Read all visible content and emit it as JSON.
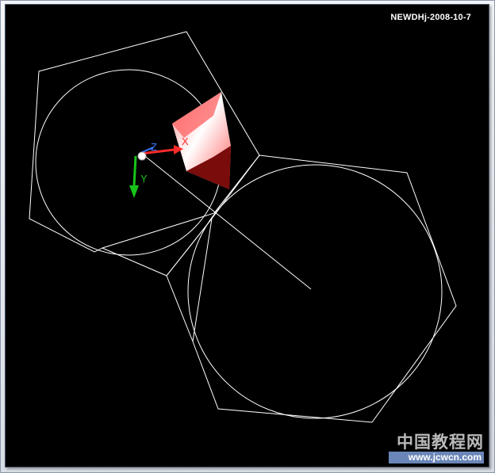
{
  "drawing": {
    "date_stamp": "NEWDHj-2008-10-7",
    "ucs_icon": {
      "x_label": "X",
      "y_label": "Y",
      "z_label": "Z"
    },
    "colors": {
      "background": "#000000",
      "geometry": "#ffffff",
      "x_axis": "#ff2a2a",
      "y_axis": "#19c419",
      "z_axis": "#3a7bff"
    }
  },
  "watermark": {
    "chinese": "中国教程网",
    "url": "www.jcwcn.com"
  }
}
